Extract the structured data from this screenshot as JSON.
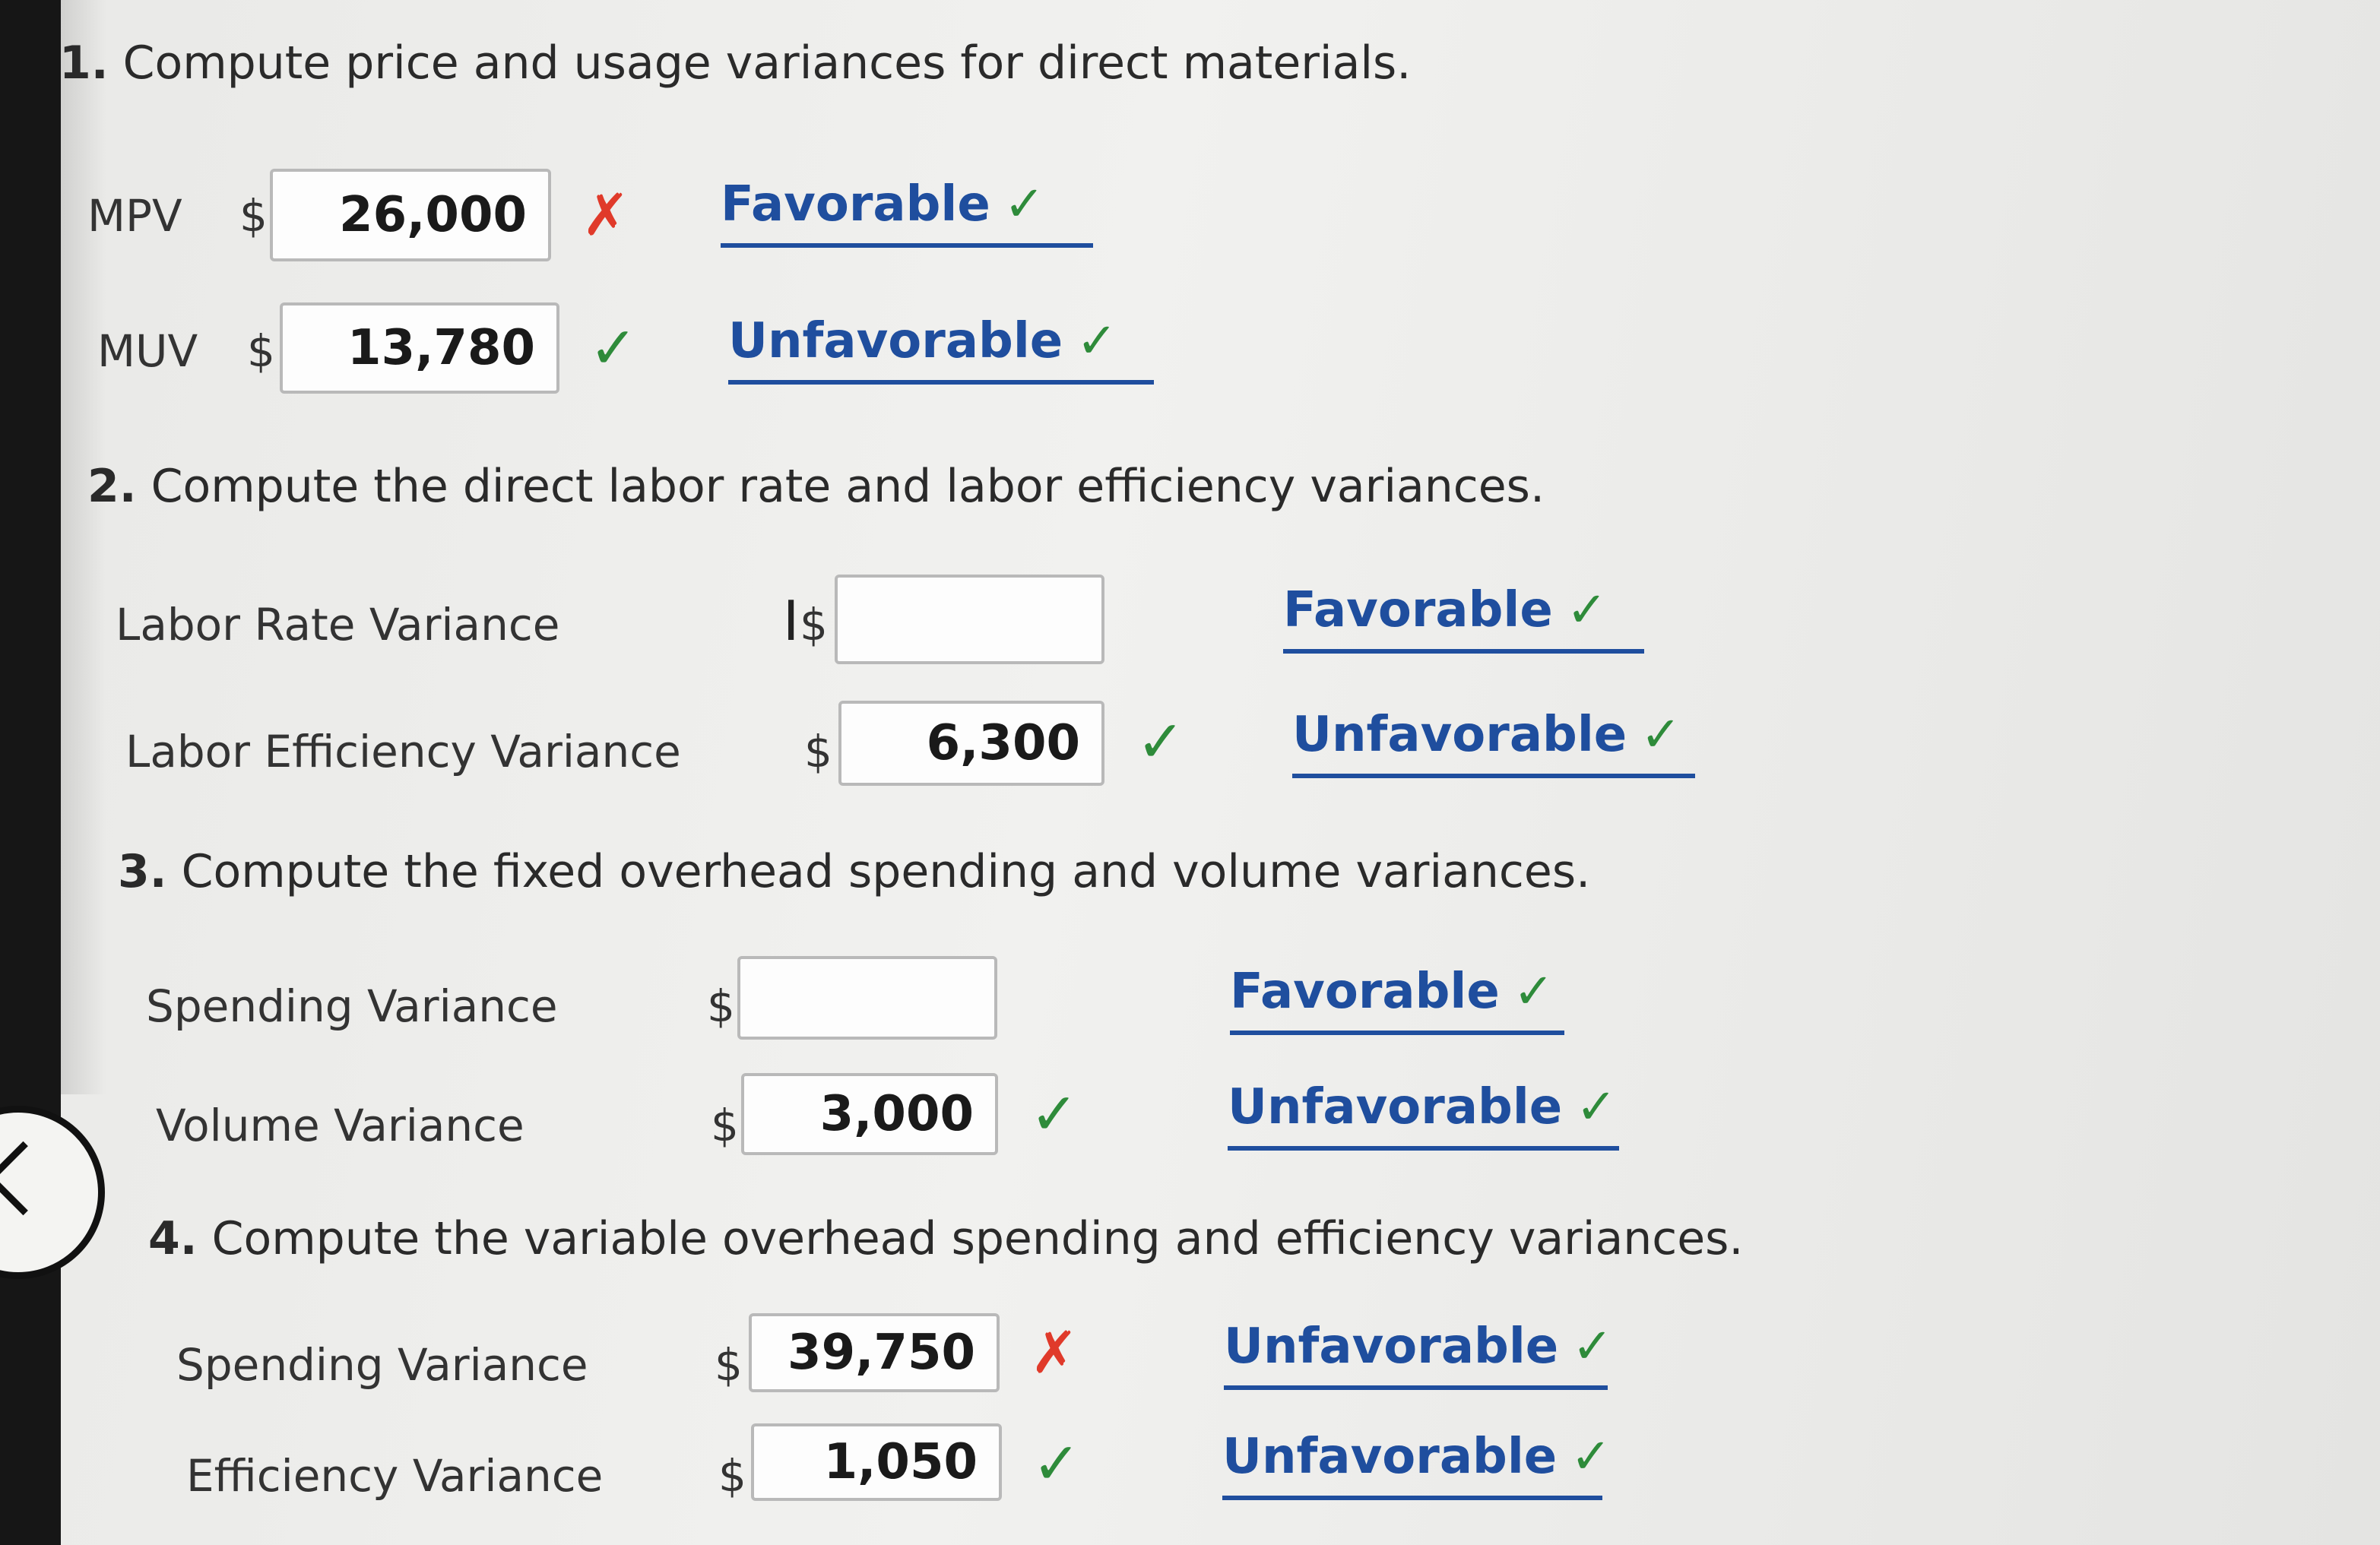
{
  "q1": {
    "heading_num": "1.",
    "heading_text": " Compute price and usage variances for direct materials.",
    "rows": [
      {
        "label": "MPV",
        "currency": "$",
        "value": "26,000",
        "mark": "✗",
        "selection": "Favorable",
        "selection_mark": "✓"
      },
      {
        "label": "MUV",
        "currency": "$",
        "value": "13,780",
        "mark": "✓",
        "selection": "Unfavorable",
        "selection_mark": "✓"
      }
    ]
  },
  "q2": {
    "heading_num": "2.",
    "heading_text": " Compute the direct labor rate and labor efficiency variances.",
    "rows": [
      {
        "label": "Labor Rate Variance",
        "currency": "$",
        "value": "",
        "selection": "Favorable",
        "selection_mark": "✓"
      },
      {
        "label": "Labor Efficiency Variance",
        "currency": "$",
        "value": "6,300",
        "mark": "✓",
        "selection": "Unfavorable",
        "selection_mark": "✓"
      }
    ]
  },
  "q3": {
    "heading_num": "3.",
    "heading_text": " Compute the fixed overhead spending and volume variances.",
    "rows": [
      {
        "label": "Spending Variance",
        "currency": "$",
        "value": "",
        "selection": "Favorable",
        "selection_mark": "✓"
      },
      {
        "label": "Volume Variance",
        "currency": "$",
        "value": "3,000",
        "mark": "✓",
        "selection": "Unfavorable",
        "selection_mark": "✓"
      }
    ]
  },
  "q4": {
    "heading_num": "4.",
    "heading_text": " Compute the variable overhead spending and efficiency variances.",
    "rows": [
      {
        "label": "Spending Variance",
        "currency": "$",
        "value": "39,750",
        "mark": "✗",
        "selection": "Unfavorable",
        "selection_mark": "✓"
      },
      {
        "label": "Efficiency Variance",
        "currency": "$",
        "value": "1,050",
        "mark": "✓",
        "selection": "Unfavorable",
        "selection_mark": "✓"
      }
    ]
  },
  "colors": {
    "correct": "#2e8b3a",
    "incorrect": "#e03a2a",
    "selection": "#1f4e9e"
  }
}
